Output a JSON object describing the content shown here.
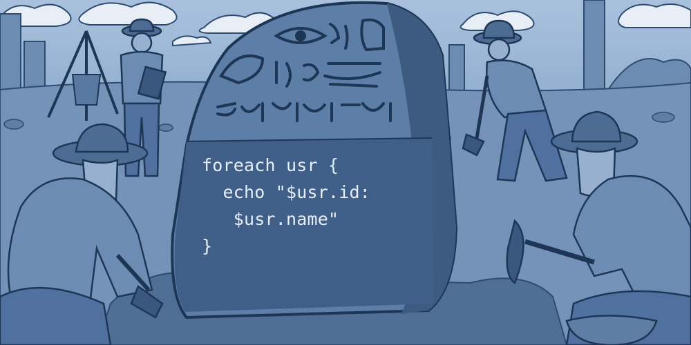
{
  "scene": {
    "description_tags": [
      "rosetta-stone",
      "archaeologists",
      "excavation"
    ],
    "palette": {
      "sky": "#a9c1dd",
      "ground": "#6f8fb3",
      "stone": "#5d7ea6",
      "stone_dark": "#3d5a80",
      "ink": "#1e3656",
      "code_text": "#e8eef7"
    }
  },
  "stone_code": {
    "lines": [
      "foreach usr {",
      "  echo \"$usr.id:",
      "   $usr.name\"",
      "}"
    ]
  }
}
